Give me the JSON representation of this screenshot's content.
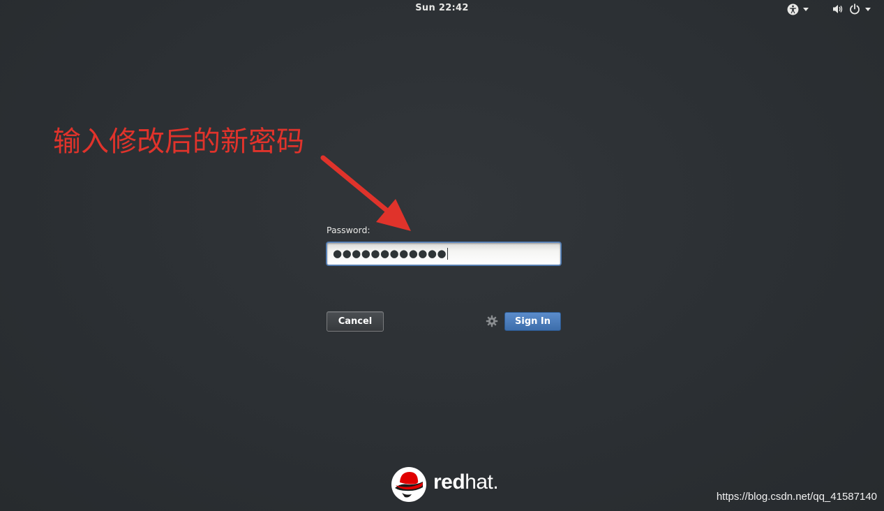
{
  "topbar": {
    "clock": "Sun 22:42",
    "icons": [
      "accessibility-icon",
      "volume-icon",
      "power-icon"
    ]
  },
  "annotation": {
    "text": "输入修改后的新密码",
    "color": "#e0332b"
  },
  "login": {
    "password_label": "Password:",
    "password_value": "●●●●●●●●●●●●",
    "cancel_label": "Cancel",
    "signin_label": "Sign In"
  },
  "logo": {
    "word_bold": "red",
    "word_light": "hat",
    "mark": "."
  },
  "watermark": "https://blog.csdn.net/qq_41587140",
  "colors": {
    "background": "#2c3034",
    "signin": "#4a7bbd",
    "focus": "#4a76ad",
    "redhat_red": "#e00000"
  }
}
